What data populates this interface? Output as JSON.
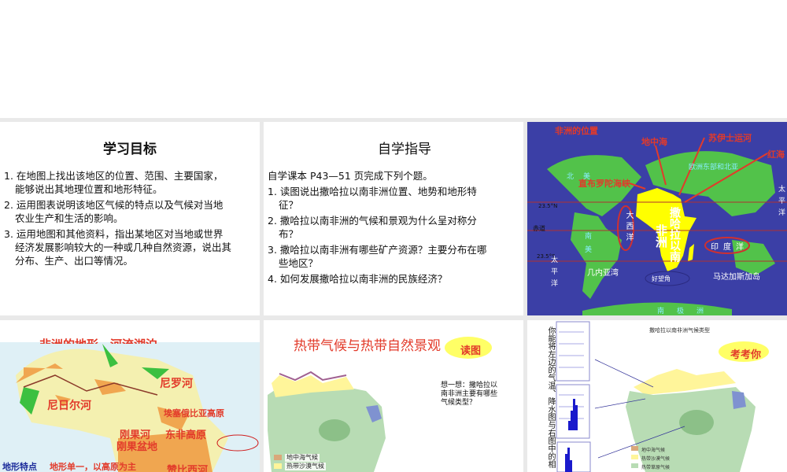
{
  "slides": [
    {
      "title": "学习目标",
      "items": [
        "1. 在地图上找出该地区的位置、范围、主要国家，能够说出其地理位置和地形特征。",
        "2. 运用图表说明该地区气候的特点以及气候对当地农业生产和生活的影响。",
        "3. 运用地图和其他资料，指出某地区对当地或世界经济发展影响较大的一种或几种自然资源，说出其分布、生产、出口等情况。"
      ]
    },
    {
      "title": "自学指导",
      "intro": "自学课本 P43—51 页完成下列个题。",
      "items": [
        "1. 读图说出撒哈拉以南非洲位置、地势和地形特征？",
        "2. 撒哈拉以南非洲的气候和景观为什么呈对称分布？",
        "3. 撒哈拉以南非洲有哪些矿产资源？主要分布在哪些地区？",
        "4. 如何发展撒哈拉以南非洲的民族经济？"
      ]
    },
    {
      "title": "非洲的位置",
      "labels": {
        "med": "地中海",
        "suez": "苏伊士运河",
        "red": "红海",
        "gib": "直布罗陀海峡",
        "eu": "欧洲东部和北亚",
        "n23": "23.5°N",
        "eq": "赤道",
        "s23": "23.5°S",
        "atl": "大西洋",
        "africa": "非洲",
        "sahara": "撒哈拉以南",
        "guinea": "几内亚湾",
        "cape": "好望角",
        "ind": "印度洋",
        "mad": "马达加斯加岛",
        "pac": "太平洋",
        "pac2": "太平洋",
        "ant": "南极洲",
        "na": "北美",
        "sa": "南美"
      }
    },
    {
      "title": "非洲的地形、河流湖泊",
      "labels": {
        "nile": "尼罗河",
        "niger": "尼日尔河",
        "eth": "埃塞俄比亚高原",
        "congo": "刚果河",
        "eaf": "东非高原",
        "basin": "刚果盆地",
        "zam": "赞比西河",
        "feat": "地形特点",
        "desc": "地形单一，以高原为主"
      }
    },
    {
      "title": "热带气候与热带自然景观",
      "badge": "读图",
      "question": "想一想：撒哈拉以南非洲主要有哪些气候类型？",
      "legend": [
        "地中海气候",
        "热带沙漠气候"
      ]
    },
    {
      "title": "撒哈拉以南非洲气候类型",
      "badge": "考考你",
      "question": "你能将左边的气温、降水图与右图中的相",
      "legend": [
        "地中海气候",
        "热带沙漠气候",
        "热带草原气候"
      ]
    }
  ],
  "colors": {
    "map_ocean": "#3b3fa6",
    "land": "#52c24a",
    "africa": "#ffff00",
    "red_label": "#e23a2a"
  }
}
